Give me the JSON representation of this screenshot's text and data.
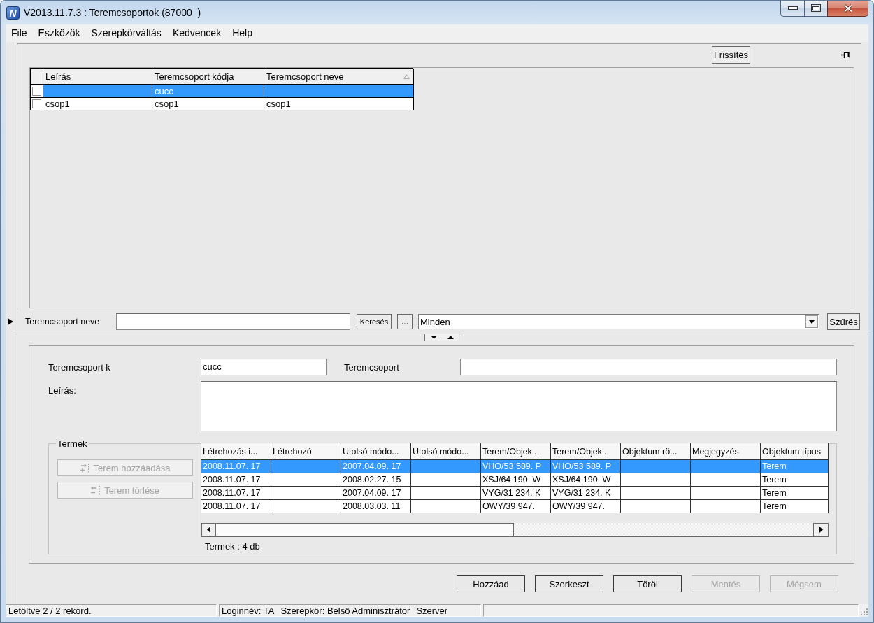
{
  "window": {
    "logo": "N",
    "title": "V2013.11.7.3 : Teremcsoportok (87000  )"
  },
  "menu": [
    "File",
    "Eszközök",
    "Szerepkörváltás",
    "Kedvencek",
    "Help"
  ],
  "toolbar": {
    "refresh_button": "Frissítés"
  },
  "groups_table": {
    "columns": [
      {
        "label": "Leírás",
        "sorted": false
      },
      {
        "label": "Teremcsoport kódja",
        "sorted": false
      },
      {
        "label": "Teremcsoport neve",
        "sorted": true
      }
    ],
    "rows": [
      {
        "selected": true,
        "checked": false,
        "cells": [
          null,
          "cucc",
          null
        ]
      },
      {
        "selected": false,
        "checked": false,
        "cells": [
          "csop1",
          "csop1",
          "csop1"
        ]
      }
    ]
  },
  "search": {
    "label": "Teremcsoport neve",
    "search_button": "Keresés",
    "browse_button": "...",
    "filter": "Minden",
    "filter_button": "Szűrés"
  },
  "detail": {
    "code_label": "Teremcsoport k",
    "code_value": "cucc",
    "name_label": "Teremcsoport",
    "description_label": "Leírás:"
  },
  "rooms": {
    "title": "Termek",
    "buttons": [
      {
        "kind": "add",
        "label": "Terem hozzáadása",
        "disabled": true
      },
      {
        "kind": "remove",
        "label": "Terem törlése",
        "disabled": true
      }
    ],
    "columns": [
      "Létrehozás i...",
      "Létrehozó",
      "Utolsó módo...",
      "Utolsó módo...",
      "Terem/Objek...",
      "Terem/Objek...",
      "Objektum rö...",
      "Megjegyzés",
      "Objektum típus"
    ],
    "rows": [
      {
        "selected": true,
        "cells": [
          "2008.11.07. 17",
          null,
          "2007.04.09. 17",
          null,
          "VHO/53 589. P",
          "VHO/53 589. P",
          null,
          null,
          "Terem"
        ]
      },
      {
        "selected": false,
        "cells": [
          "2008.11.07. 17",
          null,
          "2008.02.27. 15",
          null,
          "XSJ/64 190. W",
          "XSJ/64 190. W",
          null,
          null,
          "Terem"
        ]
      },
      {
        "selected": false,
        "cells": [
          "2008.11.07. 17",
          null,
          "2007.04.09. 17",
          null,
          "VYG/31 234. K",
          "VYG/31 234. K",
          null,
          null,
          "Terem"
        ]
      },
      {
        "selected": false,
        "cells": [
          "2008.11.07. 17",
          null,
          "2008.03.03. 11",
          null,
          "OWY/39 947.",
          "OWY/39 947.",
          null,
          null,
          "Terem"
        ]
      }
    ],
    "count": "Termek : 4 db"
  },
  "actions": [
    {
      "label": "Hozzáad",
      "disabled": false
    },
    {
      "label": "Szerkeszt",
      "disabled": false
    },
    {
      "label": "Töröl",
      "disabled": false
    },
    {
      "label": "Mentés",
      "disabled": true
    },
    {
      "label": "Mégsem",
      "disabled": true
    }
  ],
  "status_bar": {
    "message": "Letöltve 2 / 2 rekord.",
    "info": [
      "Loginnév: TA",
      "Szerepkör: Belső Adminisztrátor",
      "Szerver"
    ]
  }
}
